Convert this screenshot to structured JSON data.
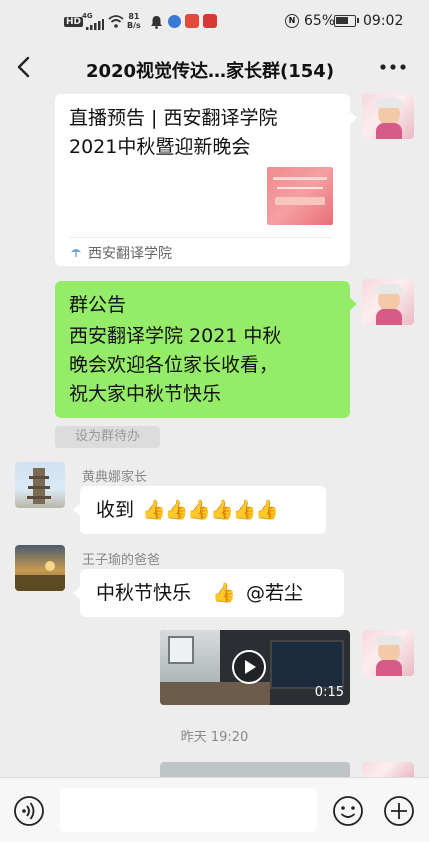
{
  "status_bar": {
    "hd": "HD",
    "signal": "4G",
    "speed_value": "81",
    "speed_unit": "B/s",
    "nfc": "N",
    "battery_percent": "65%",
    "time": "09:02"
  },
  "header": {
    "title": "2020视觉传达…家长群(154)",
    "back_icon": "chevron-left-icon",
    "more_icon": "more-dots-icon"
  },
  "messages": {
    "link_card": {
      "title_line1": "直播预告 | 西安翻译学院",
      "title_line2": "2021中秋暨迎新晚会",
      "source": "西安翻译学院"
    },
    "announcement": {
      "line1": "群公告",
      "line2": "西安翻译学院 2021 中秋",
      "line3": "晚会欢迎各位家长收看，",
      "line4": "祝大家中秋节快乐",
      "set_todo": "设为群待办"
    },
    "msg1": {
      "sender": "黄典娜家长",
      "text": "收到",
      "emoji": "👍👍👍👍👍👍"
    },
    "msg2": {
      "sender": "王子瑜的爸爸",
      "text": "中秋节快乐",
      "emoji": "👍",
      "mention": "@若尘"
    },
    "video": {
      "duration": "0:15"
    },
    "timestamp": "昨天 19:20"
  },
  "input_bar": {
    "voice_icon": "voice-icon",
    "emoji_icon": "smiley-icon",
    "plus_icon": "plus-icon"
  }
}
